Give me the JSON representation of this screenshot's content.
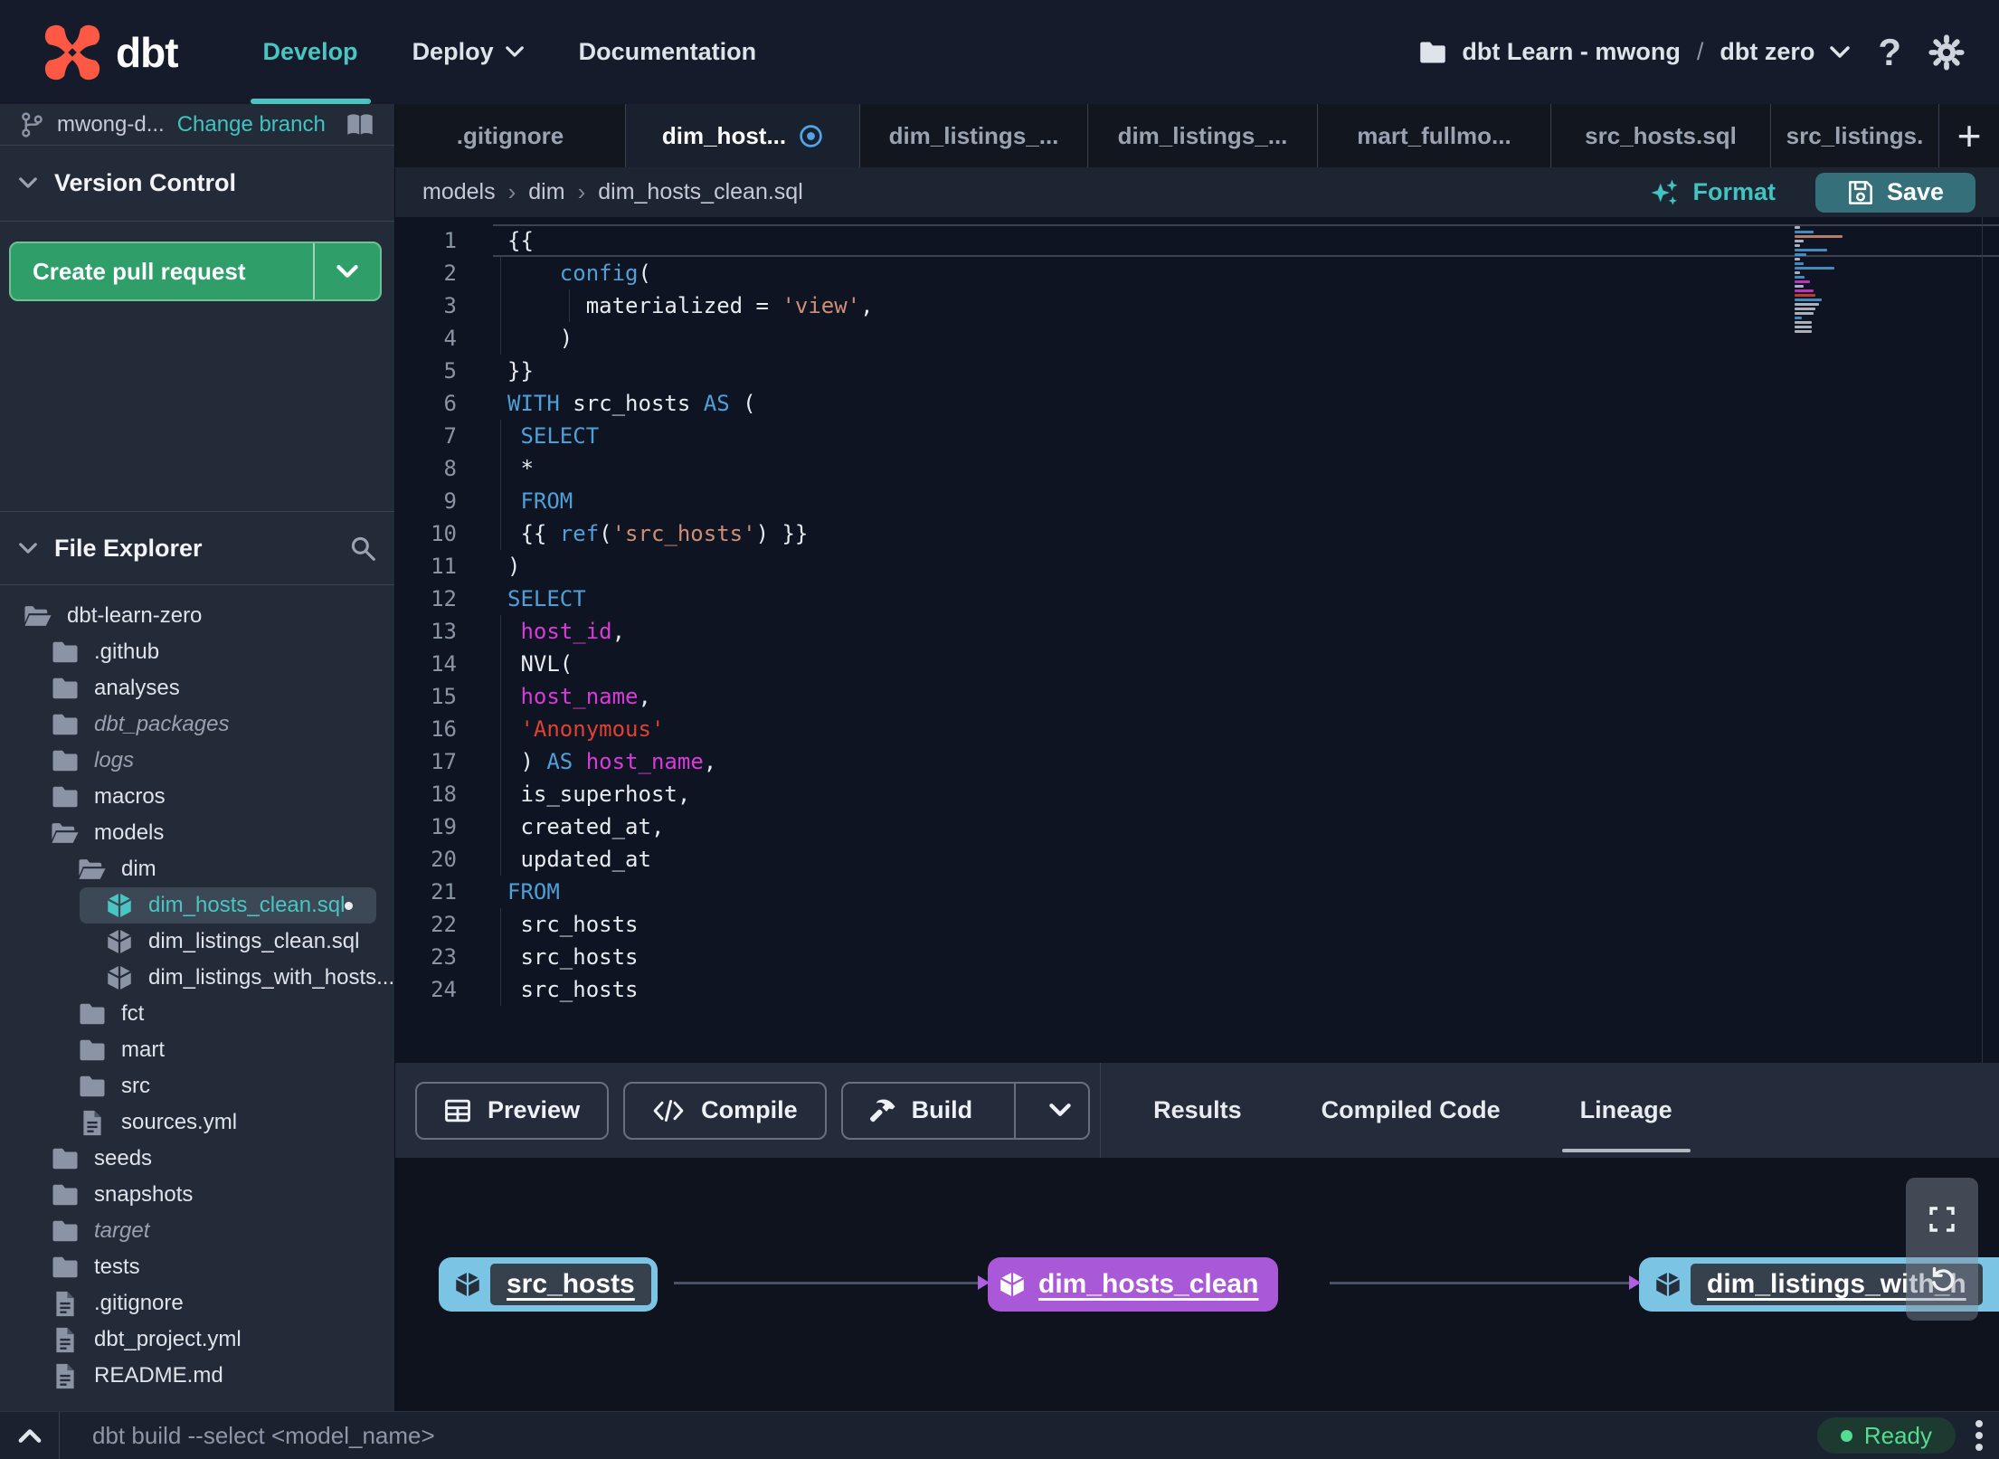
{
  "navbar": {
    "brand": "dbt",
    "menu": [
      {
        "label": "Develop",
        "active": true,
        "dropdown": false
      },
      {
        "label": "Deploy",
        "active": false,
        "dropdown": true
      },
      {
        "label": "Documentation",
        "active": false,
        "dropdown": false
      }
    ],
    "account": "dbt Learn - mwong",
    "separator": "/",
    "project": "dbt zero",
    "help": "?"
  },
  "sidebar": {
    "branch": {
      "name": "mwong-d...",
      "change_link": "Change branch"
    },
    "version_control": {
      "title": "Version Control",
      "create_pr_label": "Create pull request"
    },
    "file_explorer": {
      "title": "File Explorer",
      "tree": [
        {
          "label": "dbt-learn-zero",
          "icon": "folder-open",
          "level": 0
        },
        {
          "label": ".github",
          "icon": "folder",
          "level": 1
        },
        {
          "label": "analyses",
          "icon": "folder",
          "level": 1
        },
        {
          "label": "dbt_packages",
          "icon": "folder",
          "level": 1,
          "dimmed": true
        },
        {
          "label": "logs",
          "icon": "folder",
          "level": 1,
          "dimmed": true
        },
        {
          "label": "macros",
          "icon": "folder",
          "level": 1
        },
        {
          "label": "models",
          "icon": "folder-open",
          "level": 1
        },
        {
          "label": "dim",
          "icon": "folder-open",
          "level": 2
        },
        {
          "label": "dim_hosts_clean.sql",
          "icon": "model",
          "level": 3,
          "selected": true,
          "unsaved_dot": true
        },
        {
          "label": "dim_listings_clean.sql",
          "icon": "model",
          "level": 3
        },
        {
          "label": "dim_listings_with_hosts...",
          "icon": "model",
          "level": 3
        },
        {
          "label": "fct",
          "icon": "folder",
          "level": 2
        },
        {
          "label": "mart",
          "icon": "folder",
          "level": 2
        },
        {
          "label": "src",
          "icon": "folder",
          "level": 2
        },
        {
          "label": "sources.yml",
          "icon": "file",
          "level": 2
        },
        {
          "label": "seeds",
          "icon": "folder",
          "level": 1
        },
        {
          "label": "snapshots",
          "icon": "folder",
          "level": 1
        },
        {
          "label": "target",
          "icon": "folder",
          "level": 1,
          "dimmed": true
        },
        {
          "label": "tests",
          "icon": "folder",
          "level": 1
        },
        {
          "label": ".gitignore",
          "icon": "file",
          "level": 1
        },
        {
          "label": "dbt_project.yml",
          "icon": "file",
          "level": 1
        },
        {
          "label": "README.md",
          "icon": "file",
          "level": 1
        }
      ]
    }
  },
  "tabs": {
    "items": [
      {
        "label": ".gitignore",
        "active": false,
        "modified": false
      },
      {
        "label": "dim_host...",
        "active": true,
        "modified": true
      },
      {
        "label": "dim_listings_...",
        "active": false,
        "modified": false
      },
      {
        "label": "dim_listings_...",
        "active": false,
        "modified": false
      },
      {
        "label": "mart_fullmo...",
        "active": false,
        "modified": false
      },
      {
        "label": "src_hosts.sql",
        "active": false,
        "modified": false
      },
      {
        "label": "src_listings.",
        "active": false,
        "modified": false
      }
    ],
    "new_tab": "+"
  },
  "breadcrumb": [
    "models",
    "dim",
    "dim_hosts_clean.sql"
  ],
  "file_actions": {
    "format": "Format",
    "save": "Save"
  },
  "editor": {
    "lines": [
      {
        "n": 1,
        "current": true,
        "seg": [
          [
            "{{",
            "p"
          ]
        ]
      },
      {
        "n": 2,
        "guide": true,
        "seg": [
          [
            "    ",
            "p"
          ],
          [
            "config",
            "kw"
          ],
          [
            "(",
            "p"
          ]
        ]
      },
      {
        "n": 3,
        "guide": true,
        "guide2": true,
        "seg": [
          [
            "      materialized = ",
            "p"
          ],
          [
            "'view'",
            "str"
          ],
          [
            ",",
            "p"
          ]
        ]
      },
      {
        "n": 4,
        "guide": true,
        "seg": [
          [
            "    )",
            "p"
          ]
        ]
      },
      {
        "n": 5,
        "seg": [
          [
            "}}",
            "p"
          ]
        ]
      },
      {
        "n": 6,
        "seg": [
          [
            "WITH",
            "kw"
          ],
          [
            " src_hosts ",
            "p"
          ],
          [
            "AS",
            "kw"
          ],
          [
            " (",
            "p"
          ]
        ]
      },
      {
        "n": 7,
        "guide": true,
        "seg": [
          [
            " ",
            "p"
          ],
          [
            "SELECT",
            "kw"
          ]
        ]
      },
      {
        "n": 8,
        "guide": true,
        "seg": [
          [
            " *",
            "p"
          ]
        ]
      },
      {
        "n": 9,
        "guide": true,
        "seg": [
          [
            " ",
            "p"
          ],
          [
            "FROM",
            "kw"
          ]
        ]
      },
      {
        "n": 10,
        "guide": true,
        "seg": [
          [
            " {{ ",
            "p"
          ],
          [
            "ref",
            "kw"
          ],
          [
            "(",
            "p"
          ],
          [
            "'src_hosts'",
            "str"
          ],
          [
            ") }}",
            "p"
          ]
        ]
      },
      {
        "n": 11,
        "seg": [
          [
            ")",
            "p"
          ]
        ]
      },
      {
        "n": 12,
        "seg": [
          [
            "SELECT",
            "kw"
          ]
        ]
      },
      {
        "n": 13,
        "guide": true,
        "seg": [
          [
            " ",
            "p"
          ],
          [
            "host_id",
            "id"
          ],
          [
            ",",
            "p"
          ]
        ]
      },
      {
        "n": 14,
        "guide": true,
        "seg": [
          [
            " NVL(",
            "p"
          ]
        ]
      },
      {
        "n": 15,
        "guide": true,
        "seg": [
          [
            " ",
            "p"
          ],
          [
            "host_name",
            "id"
          ],
          [
            ",",
            "p"
          ]
        ]
      },
      {
        "n": 16,
        "guide": true,
        "seg": [
          [
            " ",
            "p"
          ],
          [
            "'Anonymous'",
            "red"
          ]
        ]
      },
      {
        "n": 17,
        "guide": true,
        "seg": [
          [
            " ) ",
            "p"
          ],
          [
            "AS",
            "kw"
          ],
          [
            " ",
            "p"
          ],
          [
            "host_name",
            "id"
          ],
          [
            ",",
            "p"
          ]
        ]
      },
      {
        "n": 18,
        "guide": true,
        "seg": [
          [
            " is_superhost,",
            "p"
          ]
        ]
      },
      {
        "n": 19,
        "guide": true,
        "seg": [
          [
            " created_at,",
            "p"
          ]
        ]
      },
      {
        "n": 20,
        "guide": true,
        "seg": [
          [
            " updated_at",
            "p"
          ]
        ]
      },
      {
        "n": 21,
        "seg": [
          [
            "FROM",
            "kw"
          ]
        ]
      },
      {
        "n": 22,
        "guide": true,
        "seg": [
          [
            " src_hosts",
            "p"
          ]
        ]
      },
      {
        "n": 23,
        "guide": true,
        "seg": [
          [
            " src_hosts",
            "p"
          ]
        ]
      },
      {
        "n": 24,
        "guide": true,
        "seg": [
          [
            " src_hosts",
            "p"
          ]
        ]
      }
    ]
  },
  "invocation_toolbar": {
    "preview": "Preview",
    "compile": "Compile",
    "build": "Build",
    "tabs": [
      {
        "label": "Results",
        "active": false
      },
      {
        "label": "Compiled Code",
        "active": false
      },
      {
        "label": "Lineage",
        "active": true
      }
    ]
  },
  "lineage": {
    "nodes": [
      {
        "label": "src_hosts",
        "style": "blue"
      },
      {
        "label": "dim_hosts_clean",
        "style": "purple"
      },
      {
        "label": "dim_listings_with_h",
        "style": "blue"
      }
    ]
  },
  "statusbar": {
    "command": "dbt build --select <model_name>",
    "status": "Ready"
  },
  "colors": {
    "accent_teal": "#49c5c2",
    "green_button": "#2f9e68",
    "save_teal": "#35707a",
    "node_blue": "#7cc4e4",
    "node_purple": "#a958d8",
    "ready_green": "#55dc92",
    "modified_blue": "#4da6e8",
    "code_keyword": "#4f9fd8",
    "code_identifier": "#d73bd8",
    "code_string": "#cf8f77",
    "code_string_red": "#e04130"
  }
}
